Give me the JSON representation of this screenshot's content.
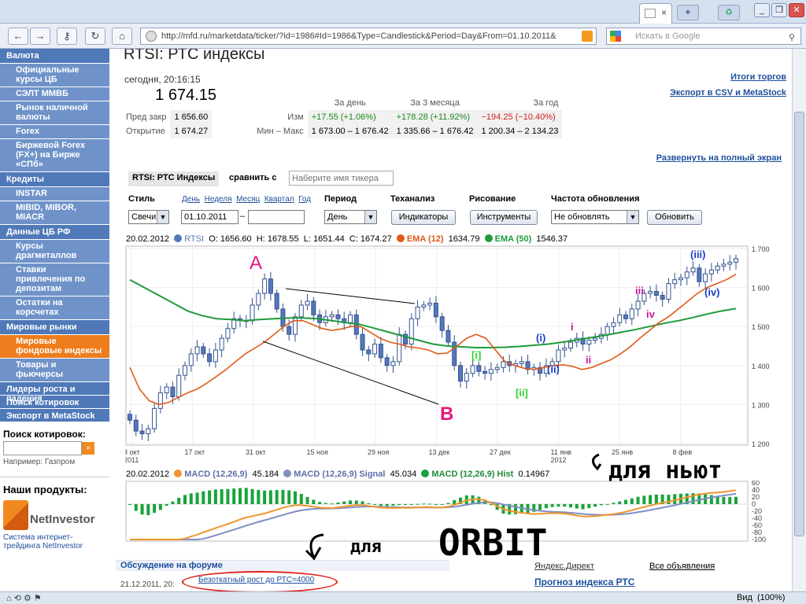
{
  "browser": {
    "url": "http://mfd.ru/marketdata/ticker/?id=1986#Id=1986&Type=Candlestick&Period=Day&From=01.10.2011&",
    "search_placeholder": "Искать в Google",
    "zoom_label": "Вид",
    "zoom": "(100%)"
  },
  "sidebar": {
    "sections": [
      {
        "head": "Валюта",
        "items": [
          "Официальные курсы ЦБ",
          "СЭЛТ ММВБ",
          "Рынок наличной валюты",
          "Forex",
          "Биржевой Forex (FX+) на Бирже «СПб»"
        ]
      },
      {
        "head": "Кредиты",
        "items": [
          "INSTAR",
          "MIBID, MIBOR, MIACR"
        ]
      },
      {
        "head": "Данные ЦБ РФ",
        "items": [
          "Курсы драгметаллов",
          "Ставки привлечения по депозитам",
          "Остатки на корсчетах"
        ]
      },
      {
        "head": "Мировые рынки",
        "items": [
          "Мировые фондовые индексы",
          "Товары и фьючерсы"
        ]
      }
    ],
    "plain": [
      "Лидеры роста и падения",
      "Поиск котировок",
      "Экспорт в MetaStock"
    ],
    "search_label": "Поиск котировок:",
    "search_go": "»",
    "example": "Например: Газпром",
    "products_label": "Наши продукты:",
    "netinvestor_logo": "NetInvestor",
    "netinvestor_text": "Система интернет-трейдинга NetInvestor"
  },
  "page": {
    "title": "RTSI: РТС индексы",
    "today": "сегодня, 20:16:15",
    "price": "1 674.15",
    "links": {
      "results": "Итоги торгов",
      "export": "Экспорт в CSV и MetaStock",
      "fullscreen": "Развернуть на полный экран"
    },
    "quote_headers": [
      "За день",
      "За 3 месяца",
      "За год"
    ],
    "prev_close_label": "Пред закр",
    "prev_close": "1 656.60",
    "change_label": "Изм",
    "changes": [
      "+17.55 (+1.06%)",
      "+178.28 (+11.92%)",
      "−194.25 (−10.40%)"
    ],
    "open_label": "Открытие",
    "open": "1 674.27",
    "minmax_label": "Мин – Макс",
    "minmax": [
      "1 673.00 – 1 676.42",
      "1 335.66 – 1 676.42",
      "1 200.34 – 2 134.23"
    ]
  },
  "controls": {
    "ticker_tab": "RTSI: РТС Индексы",
    "compare_label": "сравнить с",
    "compare_placeholder": "Наберите имя тикера",
    "style_label": "Стиль",
    "style_value": "Свечи",
    "quick_periods": [
      "День",
      "Неделя",
      "Месяц",
      "Квартал",
      "Год"
    ],
    "from_date": "01.10.2011",
    "dash": "–",
    "period_label": "Период",
    "period_value": "День",
    "ta_label": "Теханализ",
    "ta_button": "Индикаторы",
    "draw_label": "Рисование",
    "draw_button": "Инструменты",
    "refresh_label": "Частота обновления",
    "refresh_value": "Не обновлять",
    "refresh_button": "Обновить"
  },
  "legend": {
    "date": "20.02.2012",
    "rtsi": "RTSI",
    "o": "O: 1656.60",
    "h": "H: 1678.55",
    "l": "L: 1651.44",
    "c": "C: 1674.27",
    "ema12": "EMA (12)",
    "ema12_val": "1634.79",
    "ema50": "EMA (50)",
    "ema50_val": "1546.37",
    "macd_date": "20.02.2012",
    "macd": "MACD (12,26,9)",
    "macd_val": "45.184",
    "signal": "MACD (12,26,9) Signal",
    "signal_val": "45.034",
    "hist": "MACD (12,26,9) Hist",
    "hist_val": "0.14967"
  },
  "chart_data": [
    {
      "type": "candlestick",
      "x_ticks": [
        "3 окт 2011",
        "17 окт",
        "31 окт",
        "15 ноя",
        "29 ноя",
        "13 дек",
        "27 дек",
        "11 янв 2012",
        "25 янв",
        "8 фев"
      ],
      "y_ticks": [
        "1 700",
        "1 600",
        "1 500",
        "1 400",
        "1 300",
        "1 200"
      ],
      "ylim": [
        1200,
        1700
      ],
      "close": [
        1260,
        1232,
        1225,
        1238,
        1290,
        1330,
        1345,
        1320,
        1375,
        1400,
        1430,
        1448,
        1430,
        1410,
        1440,
        1470,
        1495,
        1520,
        1515,
        1515,
        1555,
        1585,
        1622,
        1585,
        1545,
        1500,
        1480,
        1525,
        1555,
        1565,
        1530,
        1510,
        1525,
        1530,
        1520,
        1510,
        1530,
        1480,
        1440,
        1430,
        1455,
        1420,
        1400,
        1410,
        1480,
        1455,
        1520,
        1550,
        1555,
        1560,
        1525,
        1490,
        1460,
        1400,
        1360,
        1380,
        1400,
        1385,
        1380,
        1390,
        1395,
        1410,
        1400,
        1405,
        1410,
        1390,
        1395,
        1380,
        1400,
        1410,
        1440,
        1445,
        1460,
        1470,
        1455,
        1465,
        1470,
        1480,
        1500,
        1510,
        1530,
        1520,
        1545,
        1565,
        1585,
        1590,
        1580,
        1570,
        1610,
        1620,
        1625,
        1640,
        1650,
        1615,
        1635,
        1645,
        1655,
        1660,
        1665,
        1674
      ],
      "ema12": [
        1395,
        1340,
        1310,
        1300,
        1305,
        1318,
        1330,
        1340,
        1355,
        1372,
        1390,
        1410,
        1430,
        1445,
        1460,
        1480,
        1500,
        1515,
        1515,
        1505,
        1495,
        1490,
        1494,
        1500,
        1500,
        1485,
        1470,
        1460,
        1455,
        1448,
        1445,
        1440,
        1430,
        1432,
        1450,
        1470,
        1480,
        1470,
        1440,
        1410,
        1400,
        1393,
        1390,
        1395,
        1400,
        1402,
        1398,
        1390,
        1395,
        1405,
        1415,
        1430,
        1448,
        1470,
        1490,
        1510,
        1525,
        1545,
        1565,
        1585,
        1600,
        1610,
        1620,
        1634
      ],
      "ema50": [
        1620,
        1600,
        1580,
        1560,
        1540,
        1528,
        1520,
        1518,
        1515,
        1518,
        1520,
        1522,
        1522,
        1520,
        1515,
        1510,
        1505,
        1495,
        1485,
        1475,
        1465,
        1455,
        1450,
        1448,
        1446,
        1446,
        1447,
        1449,
        1452,
        1455,
        1460,
        1466,
        1472,
        1478,
        1485,
        1492,
        1500,
        1508,
        1515,
        1523,
        1532,
        1540,
        1546
      ]
    },
    {
      "type": "macd",
      "y_ticks": [
        "60",
        "40",
        "20",
        "0",
        "-20",
        "-40",
        "-60",
        "-80",
        "-100"
      ],
      "ylim": [
        -100,
        60
      ]
    }
  ],
  "annotations": {
    "A": "A",
    "B": "B",
    "waves": [
      "(i)",
      "(ii)",
      "(iii)",
      "(iv)",
      "i",
      "ii",
      "iii",
      "iv",
      "[i]",
      "[ii]"
    ],
    "newt": "для ньют",
    "orbit": "для ORBIT",
    "forum_link": "Безоткатный рост до РТС=4000"
  },
  "footer": {
    "forum_title": "Обсуждение на форуме",
    "forum_date": "21.12.2011, 20:",
    "direct": "Яндекс.Директ",
    "all_ads": "Все объявления",
    "forecast": "Прогноз индекса РТС"
  },
  "colors": {
    "rtsi": "#5577bb",
    "ema12": "#e05a1a",
    "ema50": "#1f9a3a",
    "macd": "#f0962e",
    "signal": "#7f8fc4",
    "hist": "#19a33a",
    "sidebar_head": "#4f79b8",
    "sidebar_item": "#6f93c9",
    "sidebar_active": "#ee7d1e"
  }
}
